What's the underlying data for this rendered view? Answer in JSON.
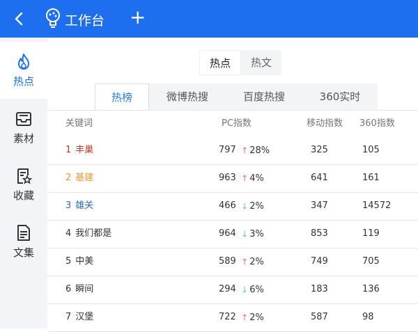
{
  "header": {
    "title": "工作台",
    "plus_symbol": "+"
  },
  "sidebar": {
    "items": [
      {
        "label": "热点",
        "icon": "flame-icon",
        "active": true
      },
      {
        "label": "素材",
        "icon": "inbox-icon",
        "active": false
      },
      {
        "label": "收藏",
        "icon": "bookmark-star-icon",
        "active": false
      },
      {
        "label": "文集",
        "icon": "document-icon",
        "active": false
      }
    ]
  },
  "segmented": [
    "热点",
    "热文"
  ],
  "tabs": [
    "热榜",
    "微博热搜",
    "百度热搜",
    "360实时"
  ],
  "table": {
    "headers": [
      "关键词",
      "PC指数",
      "移动指数",
      "360指数"
    ],
    "rows": [
      {
        "rank": "1",
        "keyword": "丰巢",
        "pc": "797",
        "trend": "up",
        "change": "28%",
        "mobile": "325",
        "idx360": "105",
        "color": "#c0392b"
      },
      {
        "rank": "2",
        "keyword": "基建",
        "pc": "963",
        "trend": "up",
        "change": "4%",
        "mobile": "641",
        "idx360": "161",
        "color": "#e69a2a"
      },
      {
        "rank": "3",
        "keyword": "雄关",
        "pc": "466",
        "trend": "down",
        "change": "2%",
        "mobile": "347",
        "idx360": "14572",
        "color": "#2a6ebb"
      },
      {
        "rank": "4",
        "keyword": "我们都是",
        "pc": "964",
        "trend": "down",
        "change": "3%",
        "mobile": "853",
        "idx360": "119",
        "color": "#333333"
      },
      {
        "rank": "5",
        "keyword": "中美",
        "pc": "589",
        "trend": "up",
        "change": "2%",
        "mobile": "749",
        "idx360": "705",
        "color": "#333333"
      },
      {
        "rank": "6",
        "keyword": "瞬间",
        "pc": "294",
        "trend": "down",
        "change": "6%",
        "mobile": "183",
        "idx360": "136",
        "color": "#333333"
      },
      {
        "rank": "7",
        "keyword": "汉堡",
        "pc": "722",
        "trend": "up",
        "change": "2%",
        "mobile": "587",
        "idx360": "98",
        "color": "#333333"
      }
    ]
  },
  "colors": {
    "accent": "#1e6ef0",
    "tab_active": "#2980d6",
    "trend_up": "#ee3333",
    "trend_down": "#2bb34a"
  }
}
